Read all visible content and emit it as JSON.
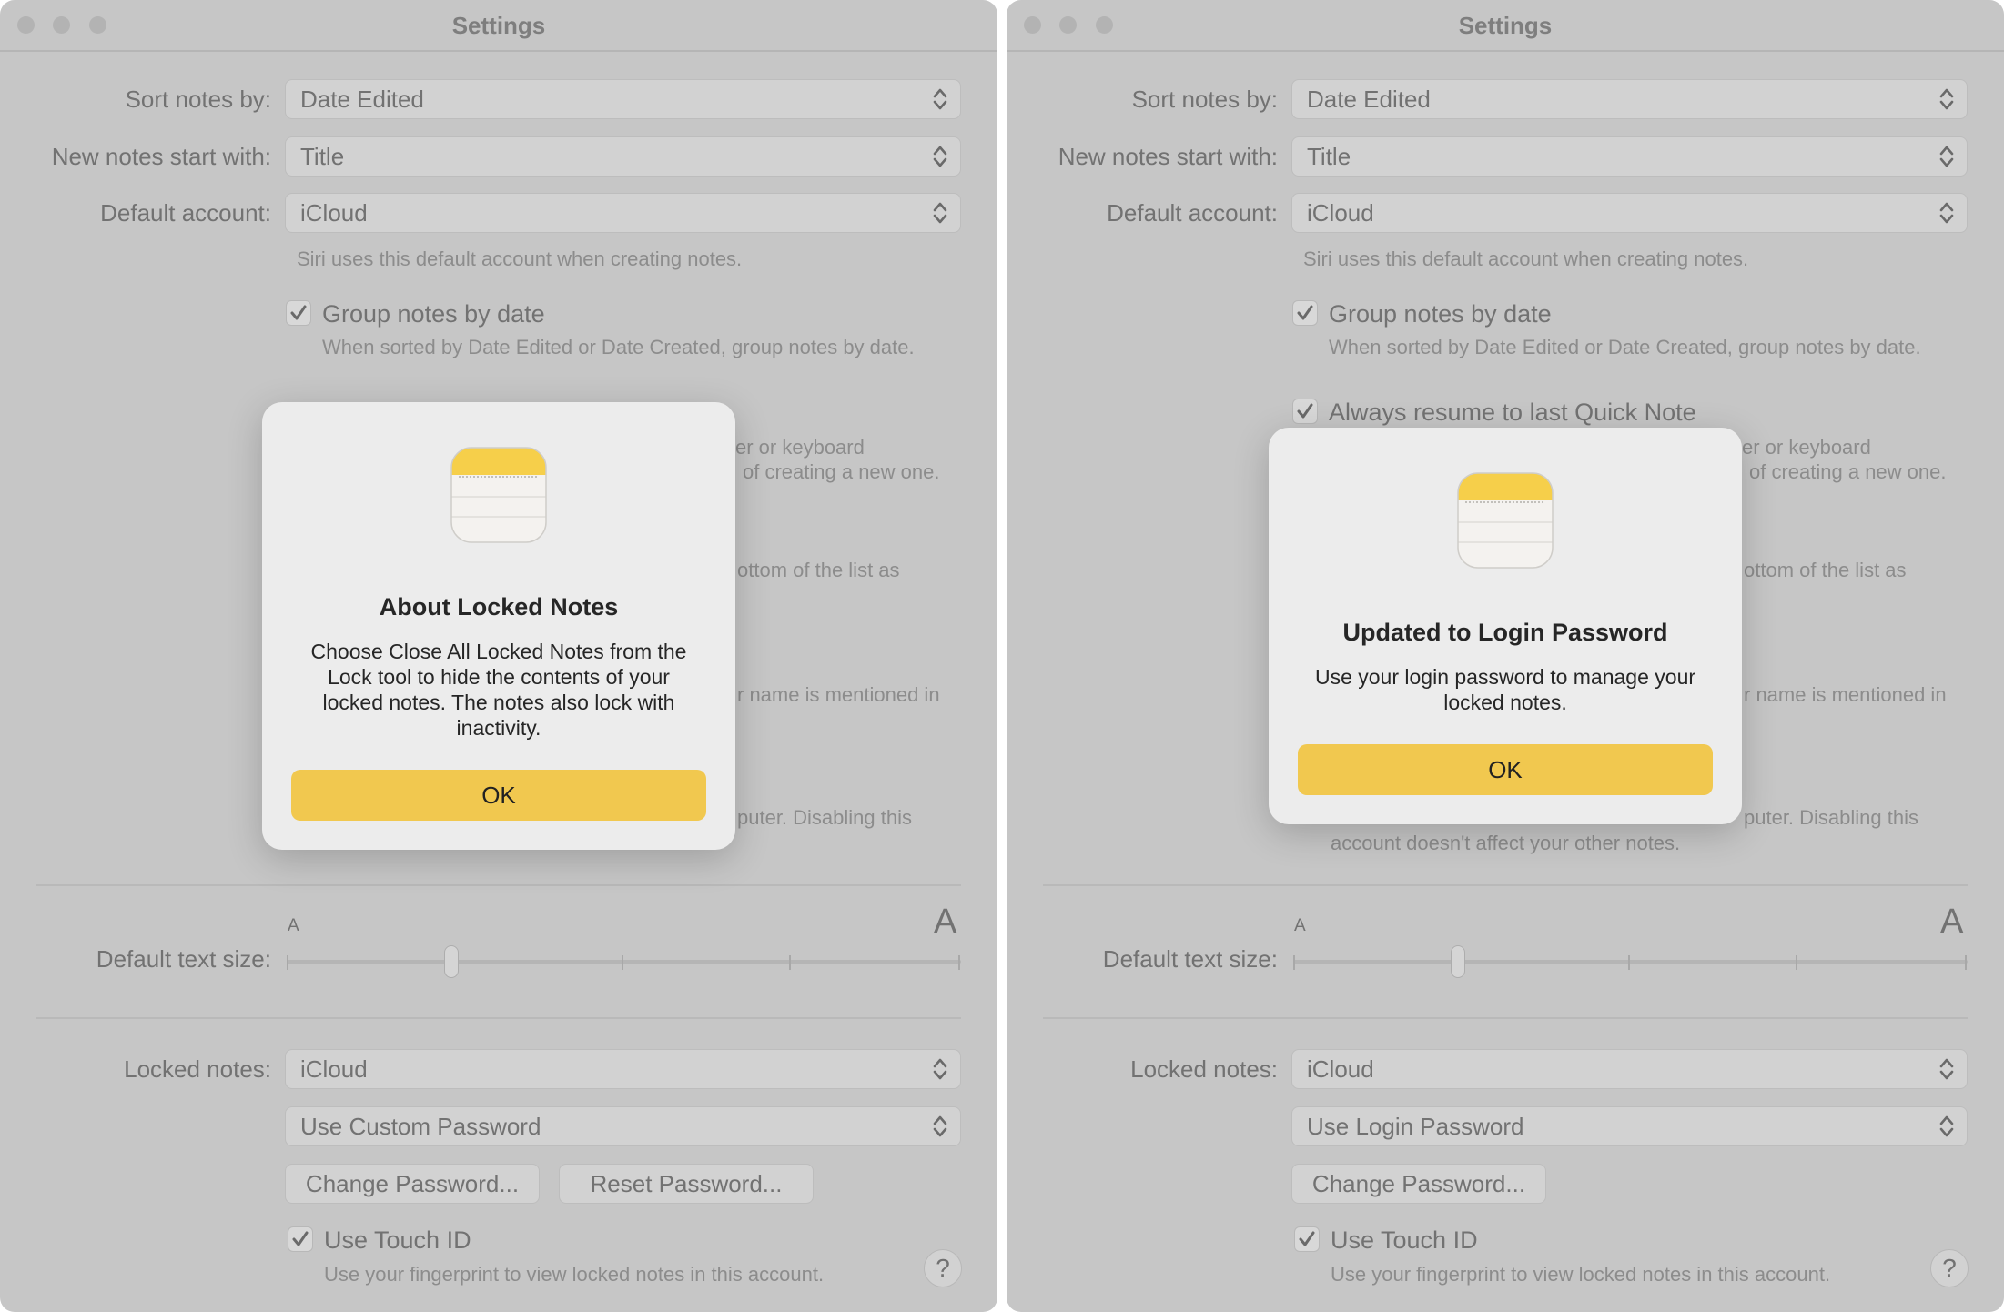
{
  "colors": {
    "window_bg": "#c6c6c6",
    "dialog_bg": "#ececec",
    "ok_button": "#f1c84f",
    "notes_yellow": "#f6cf4a"
  },
  "icons": [
    "notes-app-icon",
    "checkmark-icon",
    "popup-arrows-icon",
    "help-icon"
  ],
  "left": {
    "title": "Settings",
    "sort_label": "Sort notes by:",
    "sort_value": "Date Edited",
    "new_notes_label": "New notes start with:",
    "new_notes_value": "Title",
    "default_account_label": "Default account:",
    "default_account_value": "iCloud",
    "siri_hint": "Siri uses this default account when creating notes.",
    "group_label": "Group notes by date",
    "group_hint": "When sorted by Date Edited or Date Created, group notes by date.",
    "frag_keyboard": "er or keyboard",
    "frag_creating": "of creating a new one.",
    "frag_bottom": "ottom of the list as",
    "frag_mentioned": "r name is mentioned in",
    "frag_disabling": "puter. Disabling this",
    "text_size_label": "Default text size:",
    "small_a": "A",
    "big_a": "A",
    "text_size_level": 0.25,
    "locked_label": "Locked notes:",
    "locked_value": "iCloud",
    "password_value": "Use Custom Password",
    "change_password": "Change Password...",
    "reset_password": "Reset Password...",
    "touch_id_label": "Use Touch ID",
    "touch_id_hint": "Use your fingerprint to view locked notes in this account.",
    "help": "?",
    "dialog": {
      "title": "About Locked Notes",
      "body": "Choose Close All Locked Notes from the Lock tool to hide the contents of your locked notes. The notes also lock with inactivity.",
      "ok": "OK"
    }
  },
  "right": {
    "title": "Settings",
    "sort_label": "Sort notes by:",
    "sort_value": "Date Edited",
    "new_notes_label": "New notes start with:",
    "new_notes_value": "Title",
    "default_account_label": "Default account:",
    "default_account_value": "iCloud",
    "siri_hint": "Siri uses this default account when creating notes.",
    "group_label": "Group notes by date",
    "group_hint": "When sorted by Date Edited or Date Created, group notes by date.",
    "quick_note_label": "Always resume to last Quick Note",
    "frag_keyboard": "er or keyboard",
    "frag_creating": "of creating a new one.",
    "frag_bottom": "ottom of the list as",
    "frag_mentioned": "r name is mentioned in",
    "frag_disabling": "puter. Disabling this",
    "frag_account": "account doesn't affect your other notes.",
    "text_size_label": "Default text size:",
    "small_a": "A",
    "big_a": "A",
    "text_size_level": 0.25,
    "locked_label": "Locked notes:",
    "locked_value": "iCloud",
    "password_value": "Use Login Password",
    "change_password": "Change Password...",
    "touch_id_label": "Use Touch ID",
    "touch_id_hint": "Use your fingerprint to view locked notes in this account.",
    "help": "?",
    "dialog": {
      "title": "Updated to Login Password",
      "body": "Use your login password to manage your locked notes.",
      "ok": "OK"
    }
  }
}
